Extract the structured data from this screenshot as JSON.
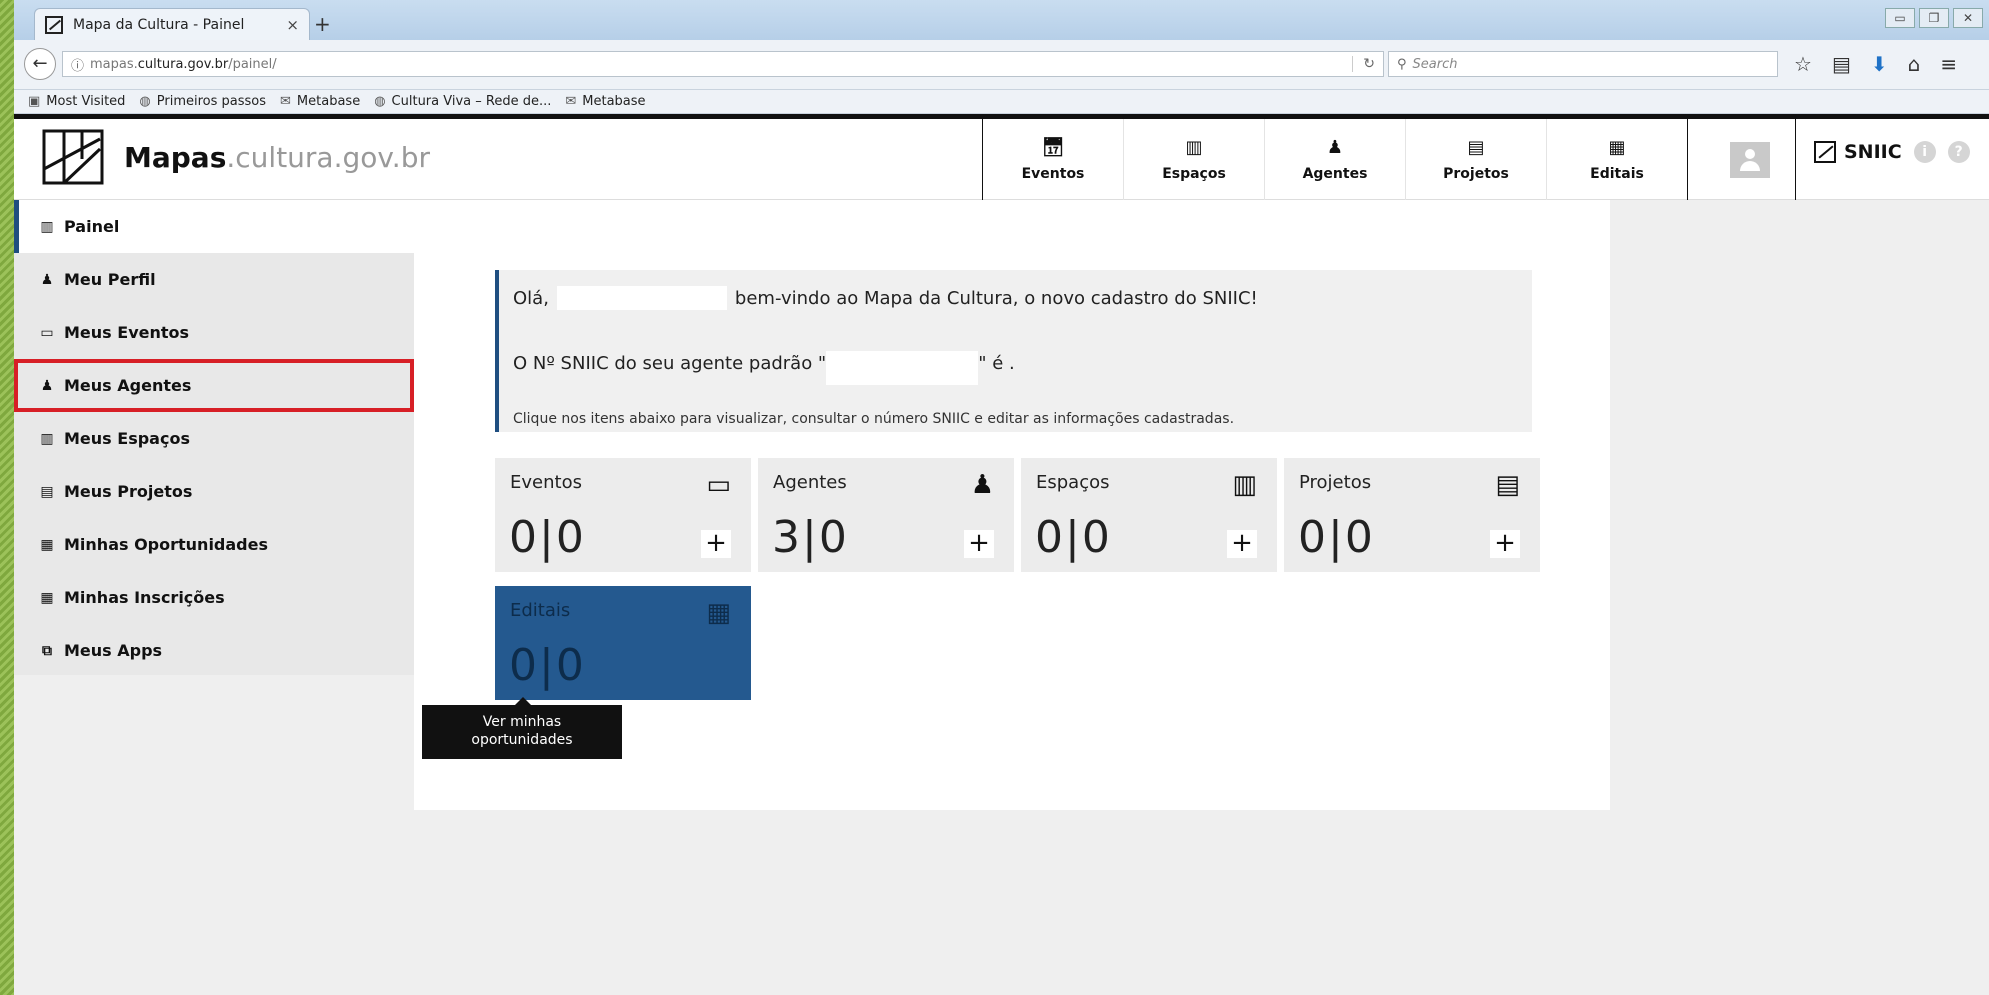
{
  "browser": {
    "tab_title": "Mapa da Cultura - Painel",
    "tab_close": "×",
    "new_tab": "+",
    "url_prefix": "mapas.",
    "url_domain": "cultura.gov.br",
    "url_path": "/painel/",
    "search_placeholder": "Search",
    "bookmarks": [
      {
        "label": "Most Visited",
        "icon": "bookmark-folder-icon"
      },
      {
        "label": "Primeiros passos",
        "icon": "globe-icon"
      },
      {
        "label": "Metabase",
        "icon": "mail-icon"
      },
      {
        "label": "Cultura Viva – Rede de...",
        "icon": "globe-icon"
      },
      {
        "label": "Metabase",
        "icon": "mail-icon"
      }
    ]
  },
  "header": {
    "logo_bold": "Mapas",
    "logo_rest": ".cultura.gov.br",
    "nav": [
      {
        "label": "Eventos",
        "icon": "calendar-icon"
      },
      {
        "label": "Espaços",
        "icon": "building-icon"
      },
      {
        "label": "Agentes",
        "icon": "person-icon"
      },
      {
        "label": "Projetos",
        "icon": "clipboard-icon"
      },
      {
        "label": "Editais",
        "icon": "document-icon"
      }
    ],
    "sniic_label": "SNIIC"
  },
  "sidebar": {
    "items": [
      {
        "label": "Painel",
        "icon": "chart-icon"
      },
      {
        "label": "Meu Perfil",
        "icon": "person-icon"
      },
      {
        "label": "Meus Eventos",
        "icon": "calendar-icon"
      },
      {
        "label": "Meus Agentes",
        "icon": "person-icon"
      },
      {
        "label": "Meus Espaços",
        "icon": "building-icon"
      },
      {
        "label": "Meus Projetos",
        "icon": "clipboard-icon"
      },
      {
        "label": "Minhas Oportunidades",
        "icon": "document-icon"
      },
      {
        "label": "Minhas Inscrições",
        "icon": "document-icon"
      },
      {
        "label": "Meus Apps",
        "icon": "puzzle-icon"
      }
    ]
  },
  "welcome": {
    "greeting": "Olá,",
    "greeting_rest": "bem-vindo ao Mapa da Cultura, o novo cadastro do SNIIC!",
    "sniic_line_start": "O Nº SNIIC do seu agente padrão \"",
    "sniic_line_end": "\" é .",
    "hint": "Clique nos itens abaixo para visualizar, consultar o número SNIIC e editar as informações cadastradas."
  },
  "cards": [
    {
      "title": "Eventos",
      "count": "0|0",
      "icon": "calendar-icon"
    },
    {
      "title": "Agentes",
      "count": "3|0",
      "icon": "person-icon"
    },
    {
      "title": "Espaços",
      "count": "0|0",
      "icon": "building-icon"
    },
    {
      "title": "Projetos",
      "count": "0|0",
      "icon": "clipboard-icon"
    },
    {
      "title": "Editais",
      "count": "0|0",
      "icon": "document-icon"
    }
  ],
  "tooltip": {
    "line1": "Ver minhas",
    "line2": "oportunidades"
  },
  "colors": {
    "accent": "#1f4e80",
    "highlight": "#d71f26",
    "editais_card": "#24598f"
  }
}
